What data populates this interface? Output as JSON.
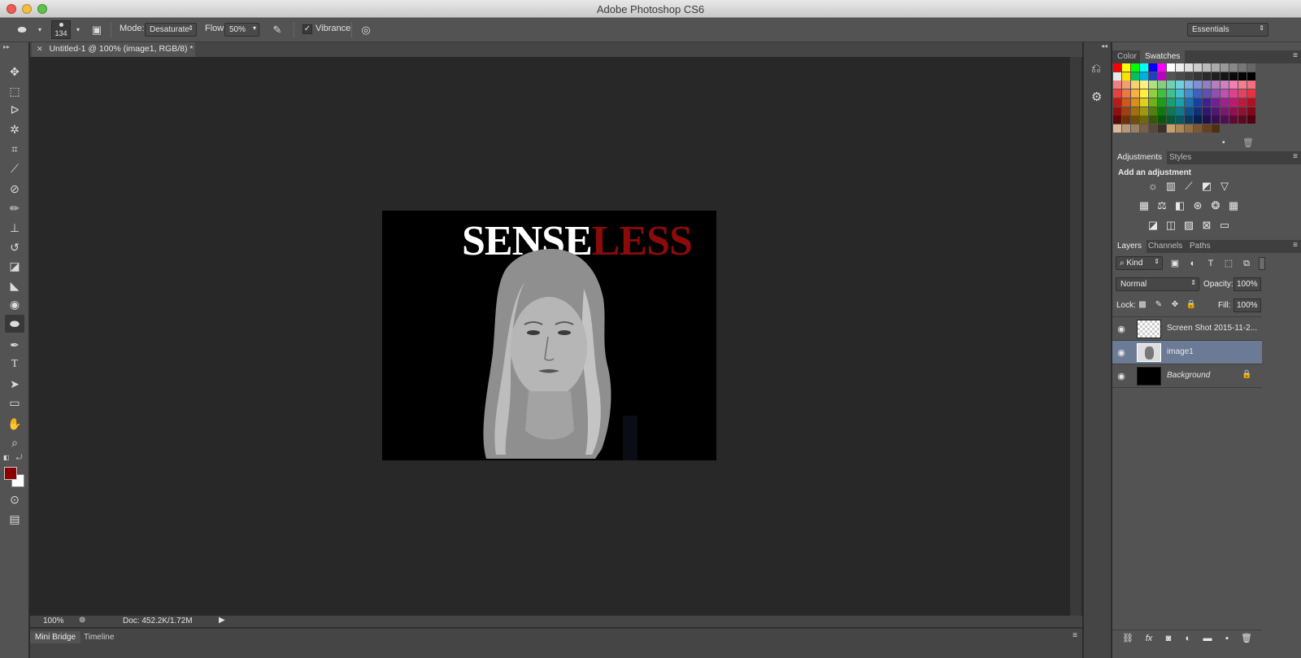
{
  "app": {
    "title": "Adobe Photoshop CS6"
  },
  "options": {
    "brush_size": "134",
    "mode_label": "Mode:",
    "mode_value": "Desaturate",
    "flow_label": "Flow:",
    "flow_value": "50%",
    "vibrance_label": "Vibrance",
    "vibrance_checked": true,
    "workspace": "Essentials"
  },
  "document": {
    "tab_title": "Untitled-1 @ 100% (image1, RGB/8) *",
    "title_white": "SENSE",
    "title_red": "LESS"
  },
  "status": {
    "zoom": "100%",
    "doc": "Doc: 452.2K/1.72M"
  },
  "bottom_tabs": [
    "Mini Bridge",
    "Timeline"
  ],
  "color_panel": {
    "tabs": [
      "Color",
      "Swatches"
    ]
  },
  "adjustments_panel": {
    "tabs": [
      "Adjustments",
      "Styles"
    ],
    "heading": "Add an adjustment"
  },
  "layers_panel": {
    "tabs": [
      "Layers",
      "Channels",
      "Paths"
    ],
    "filter": "Kind",
    "blend_mode": "Normal",
    "opacity_label": "Opacity:",
    "opacity_value": "100%",
    "lock_label": "Lock:",
    "fill_label": "Fill:",
    "fill_value": "100%",
    "layers": [
      {
        "name": "Screen Shot 2015-11-2...",
        "selected": false,
        "locked": false
      },
      {
        "name": "image1",
        "selected": true,
        "locked": false
      },
      {
        "name": "Background",
        "selected": false,
        "locked": true
      }
    ]
  },
  "colors": {
    "foreground": "#8b0000",
    "background": "#ffffff",
    "title_red": "#8b0a0a",
    "selected_layer": "#6b7b96"
  },
  "icons": [
    "move-icon",
    "marquee-icon",
    "lasso-icon",
    "magic-wand-icon",
    "crop-icon",
    "eyedropper-icon",
    "healing-icon",
    "brush-icon",
    "stamp-icon",
    "history-brush-icon",
    "eraser-icon",
    "bucket-icon",
    "blur-icon",
    "sponge-icon",
    "pen-icon",
    "type-icon",
    "path-select-icon",
    "rectangle-icon",
    "hand-icon",
    "zoom-icon"
  ]
}
